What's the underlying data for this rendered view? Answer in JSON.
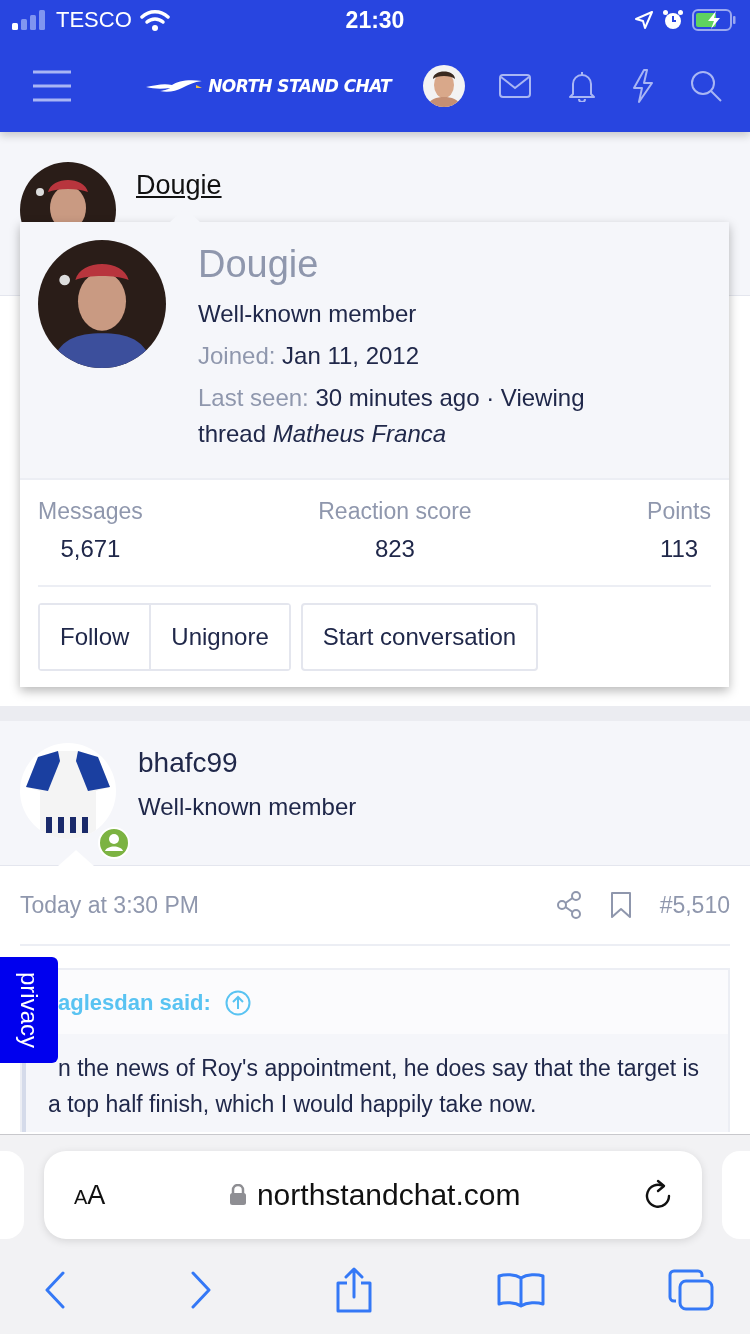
{
  "status_bar": {
    "carrier": "TESCO",
    "time": "21:30"
  },
  "header": {
    "logo": "NORTH STAND CHAT"
  },
  "post_1": {
    "username": "Dougie"
  },
  "popup": {
    "name": "Dougie",
    "title": "Well-known member",
    "joined_label": "Joined:",
    "joined": "Jan 11, 2012",
    "last_seen_label": "Last seen:",
    "last_seen": "30 minutes ago · Viewing thread *Matheus Franca*",
    "stats": [
      {
        "label": "Messages",
        "value": "5,671"
      },
      {
        "label": "Reaction score",
        "value": "823"
      },
      {
        "label": "Points",
        "value": "113"
      }
    ],
    "buttons": [
      "Follow",
      "Unignore",
      "Start conversation"
    ]
  },
  "post_2": {
    "username": "bhafc99",
    "title": "Well-known member",
    "online": true,
    "time": "Today at 3:30 PM",
    "number": "#5,510",
    "quote_author": "aglesdan said:",
    "quote_text": "n the news of Roy's appointment, he does say that the target is a top half finish, which I would happily take now."
  },
  "privacy_tab": "privacy",
  "browser": {
    "text_size": [
      "A",
      "A"
    ],
    "url": "northstandchat.com"
  }
}
